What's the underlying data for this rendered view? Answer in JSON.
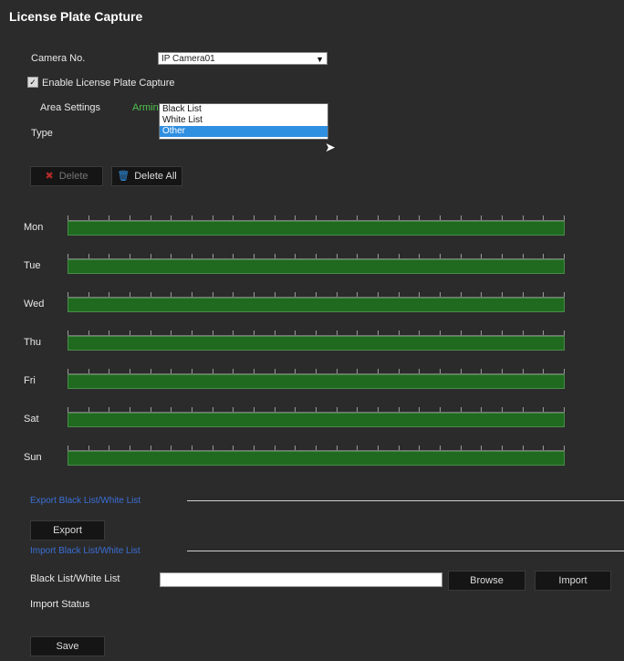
{
  "page": {
    "title": "License Plate Capture"
  },
  "camera": {
    "label": "Camera No.",
    "value": "IP Camera01"
  },
  "enable": {
    "checked": true,
    "label": "Enable License Plate Capture"
  },
  "tabs": [
    {
      "label": "Area Settings"
    },
    {
      "label": "Arming Schedule"
    }
  ],
  "type": {
    "label": "Type",
    "options": [
      "Black List",
      "White List",
      "Other"
    ],
    "selected": "Other"
  },
  "schedule_buttons": {
    "delete": "Delete",
    "delete_all": "Delete All"
  },
  "days": [
    "Mon",
    "Tue",
    "Wed",
    "Thu",
    "Fri",
    "Sat",
    "Sun"
  ],
  "export_section": {
    "title": "Export Black List/White List",
    "button": "Export"
  },
  "import_section": {
    "title": "Import Black List/White List",
    "field_label": "Black List/White List",
    "browse": "Browse",
    "import": "Import",
    "status_label": "Import Status"
  },
  "save": "Save",
  "colors": {
    "background": "#2b2b2b",
    "timeline_fill": "#1f6a1f",
    "selected_option": "#2f8fe0",
    "section_title": "#3b6fd6",
    "active_tab": "#4fc24f"
  }
}
